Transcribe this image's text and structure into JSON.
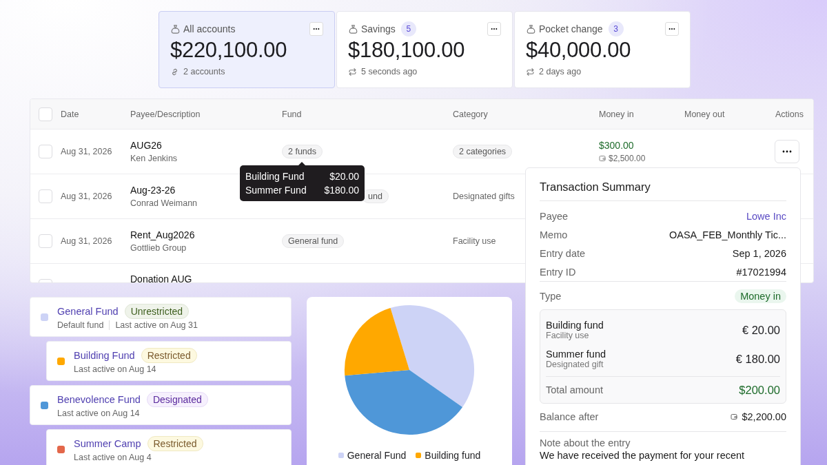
{
  "accounts": [
    {
      "label": "All accounts",
      "amount": "$220,100.00",
      "meta": "2 accounts",
      "kind": "linked",
      "selected": true
    },
    {
      "label": "Savings",
      "count": "5",
      "amount": "$180,100.00",
      "meta": "5 seconds ago",
      "kind": "synced",
      "selected": false
    },
    {
      "label": "Pocket change",
      "count": "3",
      "amount": "$40,000.00",
      "meta": "2 days ago",
      "kind": "synced",
      "selected": false
    }
  ],
  "table": {
    "select_all": {
      "checked": false
    },
    "columns": [
      "Date",
      "Payee/Description",
      "Fund",
      "Category",
      "Money in",
      "Money out",
      "Actions"
    ],
    "rows": [
      {
        "date": "Aug 31, 2026",
        "payee": "AUG26",
        "description": "Ken Jenkins",
        "fund": {
          "text": "2 funds"
        },
        "category": {
          "text": "2 categories",
          "pill": true
        },
        "money_in": "$300.00",
        "balance": "$2,500.00",
        "actions": true,
        "checked": false
      },
      {
        "date": "Aug 31, 2026",
        "payee": "Aug-23-26",
        "description": "Conrad Weimann",
        "fund": {
          "text": "und",
          "covered": true
        },
        "category": {
          "text": "Designated gifts",
          "pill": false
        },
        "checked": false
      },
      {
        "date": "Aug 31, 2026",
        "payee": "Rent_Aug2026",
        "description": "Gottlieb Group",
        "fund": {
          "text": "General fund"
        },
        "category": {
          "text": "Facility use",
          "pill": false
        },
        "checked": false
      },
      {
        "payee": "Donation AUG",
        "checked": false
      }
    ]
  },
  "tooltip": {
    "rows": [
      {
        "label": "Building Fund",
        "value": "$20.00"
      },
      {
        "label": "Summer Fund",
        "value": "$180.00"
      }
    ]
  },
  "funds": [
    {
      "name": "General Fund",
      "color": "#cdd3f6",
      "tag": {
        "text": "Unrestricted",
        "kind": "unrestricted"
      },
      "note": "Default fund",
      "activity": "Last active on Aug 31",
      "children": [
        {
          "name": "Building Fund",
          "color": "#ffa800",
          "tag": {
            "text": "Restricted",
            "kind": "restricted"
          },
          "activity": "Last active on Aug 14"
        }
      ]
    },
    {
      "name": "Benevolence Fund",
      "color": "#4f97d8",
      "tag": {
        "text": "Designated",
        "kind": "designated"
      },
      "activity": "Last active on Aug 14",
      "children": [
        {
          "name": "Summer Camp",
          "color": "#e3674a",
          "tag": {
            "text": "Restricted",
            "kind": "restricted"
          },
          "activity": "Last active on Aug 4"
        }
      ]
    }
  ],
  "chart": {
    "kind": "picture",
    "legend": [
      {
        "label": "General Fund",
        "color": "#cdd3f6"
      },
      {
        "label": "Building fund",
        "color": "#ffa800"
      }
    ]
  },
  "summary": {
    "title": "Transaction Summary",
    "details": [
      {
        "label": "Payee",
        "value": "Lowe Inc",
        "kind": "link"
      },
      {
        "label": "Memo",
        "value": "OASA_FEB_Monthly Tic...",
        "kind": "text"
      },
      {
        "label": "Entry date",
        "value": "Sep 1, 2026",
        "kind": "text"
      },
      {
        "label": "Entry ID",
        "value": "#17021994",
        "kind": "text"
      }
    ],
    "type": {
      "label": "Type",
      "value": "Money in"
    },
    "splits": [
      {
        "fund": "Building fund",
        "category": "Facility use",
        "amount": "€ 20.00"
      },
      {
        "fund": "Summer fund",
        "category": "Designated gift",
        "amount": "€ 180.00"
      }
    ],
    "total": {
      "label": "Total amount",
      "value": "$200.00"
    },
    "balance": {
      "label": "Balance after",
      "value": "$2,200.00"
    },
    "note": {
      "label": "Note about the entry",
      "text": "We have received the payment for your recent"
    }
  }
}
